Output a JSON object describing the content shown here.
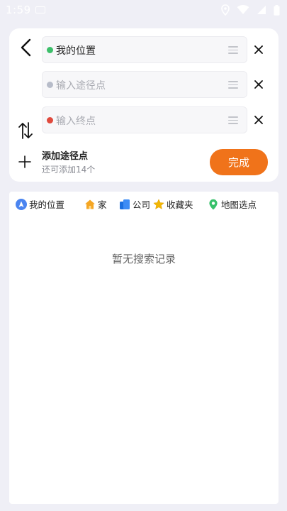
{
  "status": {
    "time": "1:59"
  },
  "route": {
    "origin": {
      "text": "我的位置",
      "dot_color": "#3cbf6a"
    },
    "waypoint": {
      "placeholder": "输入途径点",
      "dot_color": "#b7bcc9"
    },
    "destination": {
      "placeholder": "输入终点",
      "dot_color": "#e04a3d"
    }
  },
  "add_waypoint": {
    "title": "添加途径点",
    "subtitle": "还可添加14个"
  },
  "done_label": "完成",
  "quick_links": [
    {
      "label": "我的位置",
      "icon": "navigation-arrow-icon"
    },
    {
      "label": "家",
      "icon": "home-icon"
    },
    {
      "label": "公司",
      "icon": "company-icon"
    },
    {
      "label": "收藏夹",
      "icon": "star-icon"
    },
    {
      "label": "地图选点",
      "icon": "map-pin-icon"
    }
  ],
  "empty_state": "暂无搜索记录",
  "colors": {
    "accent": "#f0731a",
    "background": "#efeff6"
  }
}
